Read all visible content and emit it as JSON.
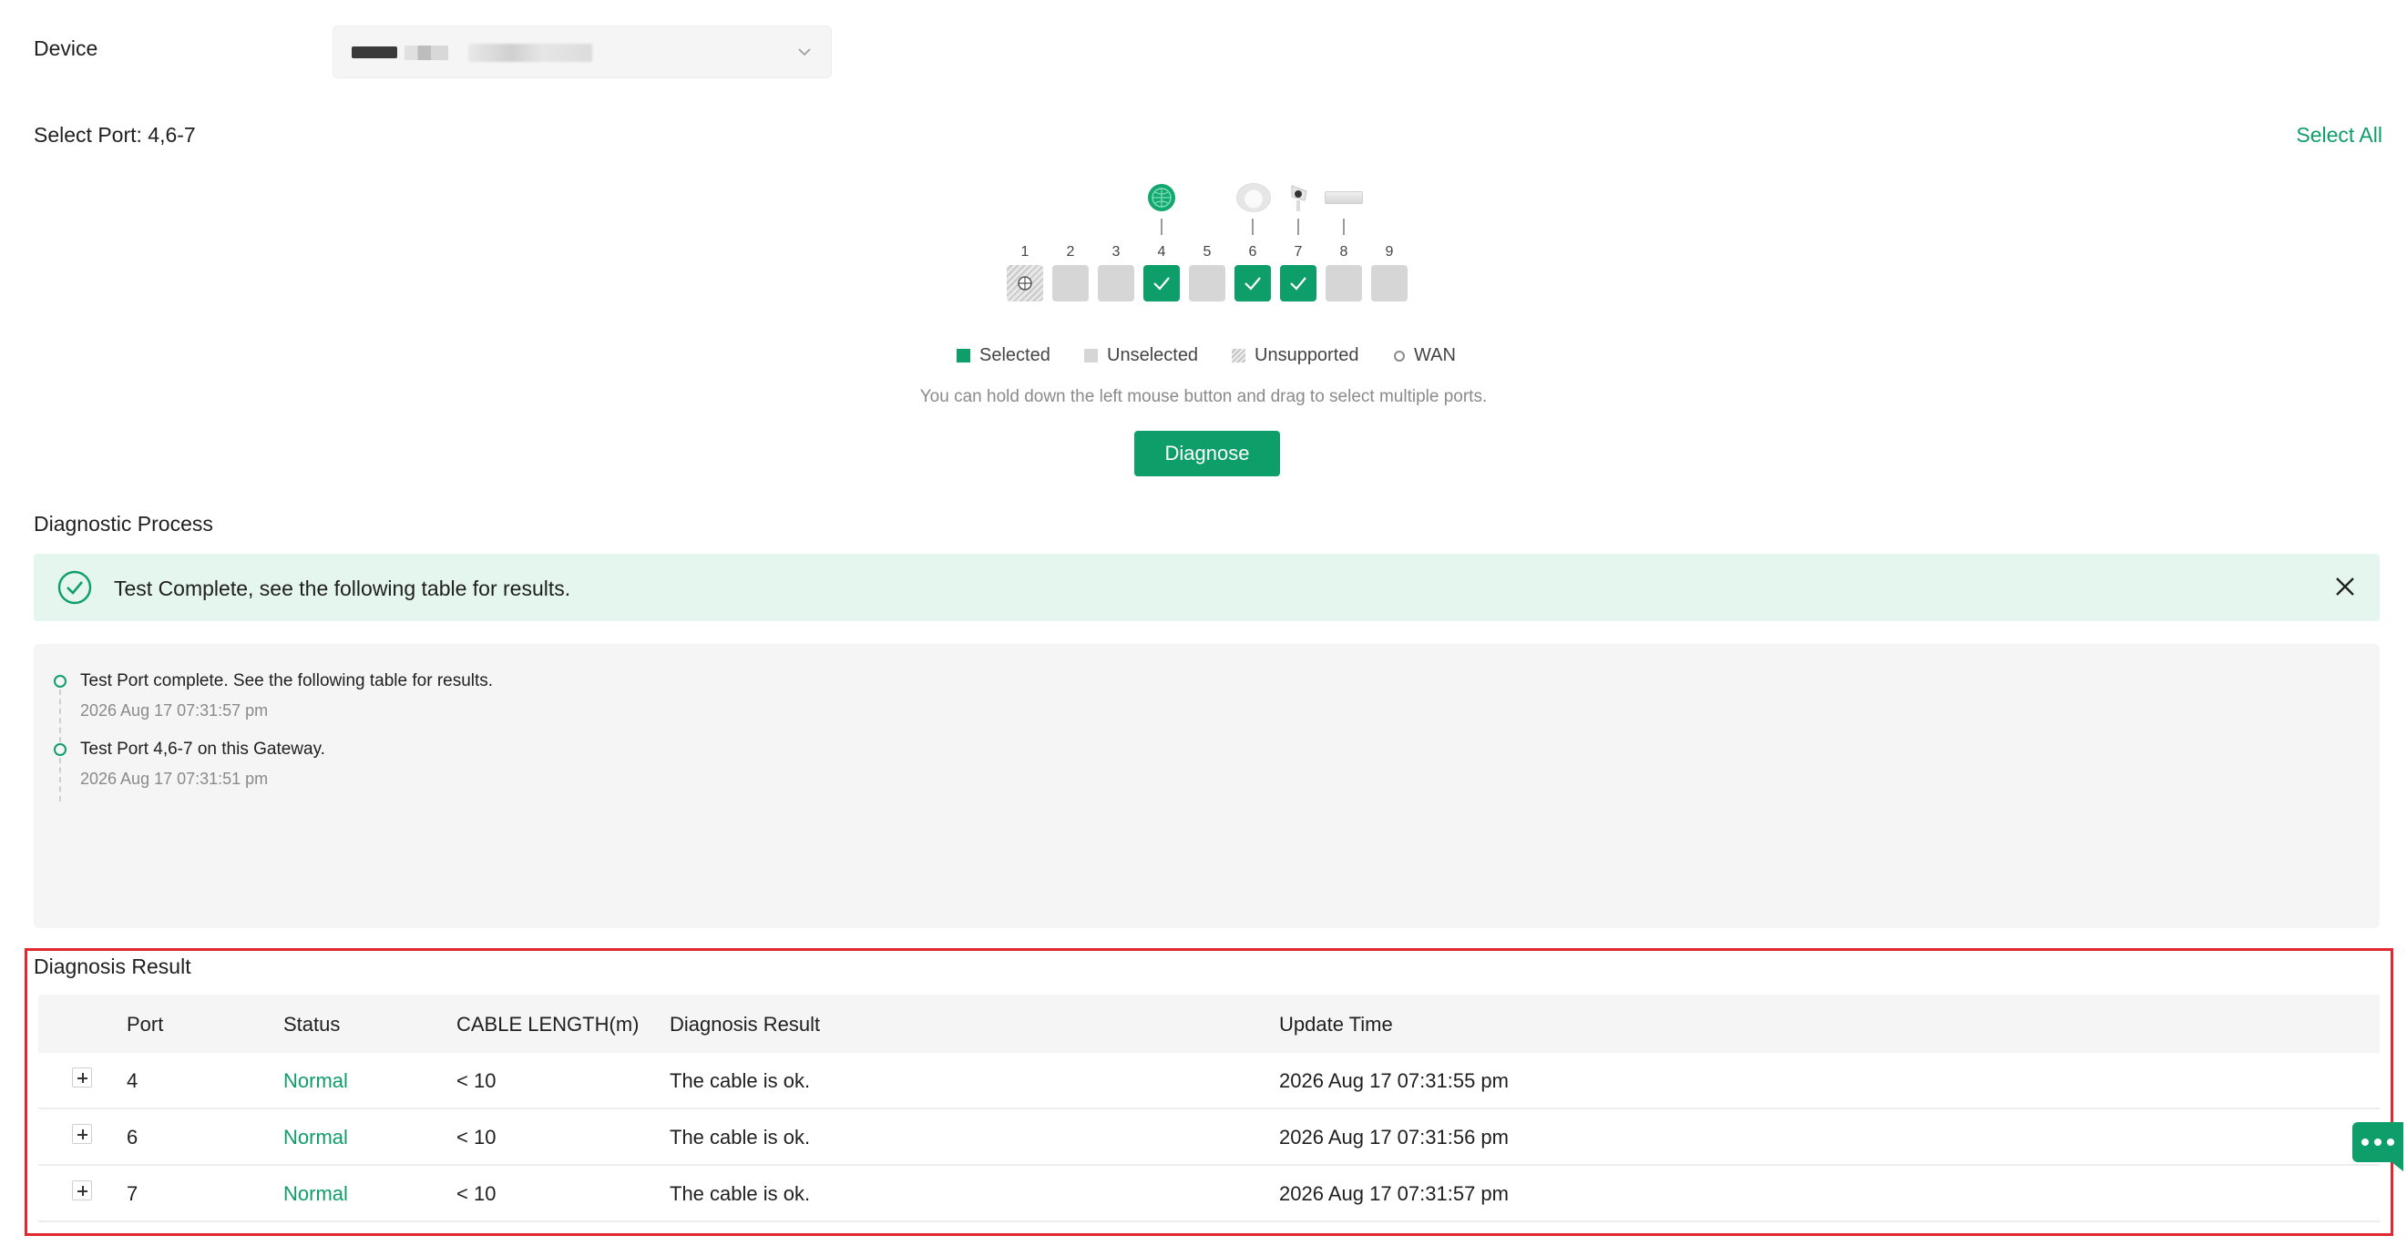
{
  "device": {
    "label": "Device",
    "chevron_icon": "chevron-down-icon"
  },
  "port_select": {
    "label": "Select Port: 4,6-7",
    "select_all": "Select All",
    "ports": [
      {
        "num": "1",
        "state": "wan"
      },
      {
        "num": "2",
        "state": "unselected"
      },
      {
        "num": "3",
        "state": "unselected"
      },
      {
        "num": "4",
        "state": "selected",
        "device": "gateway-globe-icon"
      },
      {
        "num": "5",
        "state": "unselected"
      },
      {
        "num": "6",
        "state": "selected",
        "device": "access-point-icon"
      },
      {
        "num": "7",
        "state": "selected",
        "device": "camera-icon"
      },
      {
        "num": "8",
        "state": "unselected",
        "device": "switch-icon"
      },
      {
        "num": "9",
        "state": "unselected"
      }
    ],
    "legend": {
      "selected": "Selected",
      "unselected": "Unselected",
      "unsupported": "Unsupported",
      "wan": "WAN"
    },
    "hint": "You can hold down the left mouse button and drag to select multiple ports.",
    "diagnose_button": "Diagnose"
  },
  "process": {
    "title": "Diagnostic Process",
    "banner_text": "Test Complete, see the following table for results.",
    "timeline": [
      {
        "title": "Test Port complete. See the following table for results.",
        "time": "2026 Aug 17 07:31:57 pm"
      },
      {
        "title": "Test Port 4,6-7 on this Gateway.",
        "time": "2026 Aug 17 07:31:51 pm"
      }
    ]
  },
  "result": {
    "title": "Diagnosis Result",
    "columns": [
      "Port",
      "Status",
      "CABLE LENGTH(m)",
      "Diagnosis Result",
      "Update Time"
    ],
    "rows": [
      {
        "port": "4",
        "status": "Normal",
        "length": "< 10",
        "result": "The cable is ok.",
        "time": "2026 Aug 17 07:31:55 pm"
      },
      {
        "port": "6",
        "status": "Normal",
        "length": "< 10",
        "result": "The cable is ok.",
        "time": "2026 Aug 17 07:31:56 pm"
      },
      {
        "port": "7",
        "status": "Normal",
        "length": "< 10",
        "result": "The cable is ok.",
        "time": "2026 Aug 17 07:31:57 pm"
      }
    ]
  },
  "colors": {
    "accent": "#0e9e6a",
    "banner_bg": "#e5f6ef",
    "highlight_frame": "#e0282e"
  }
}
